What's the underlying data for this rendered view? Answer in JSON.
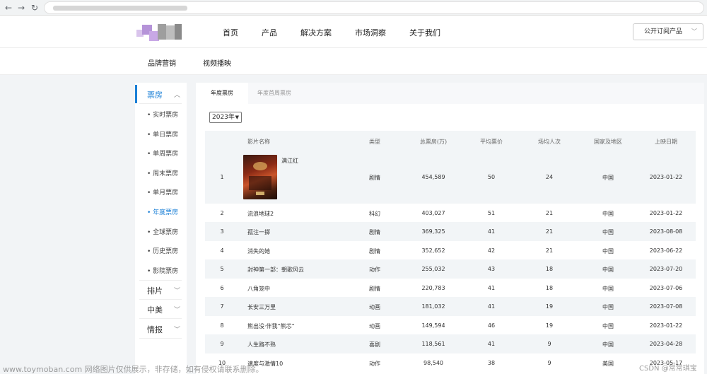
{
  "header": {
    "nav": [
      "首页",
      "产品",
      "解决方案",
      "市场洞察",
      "关于我们"
    ],
    "subscribe": "公开订阅产品"
  },
  "subnav": [
    "品牌营销",
    "视频播映"
  ],
  "sidebar": {
    "box_office": "票房",
    "sub_items": [
      "实时票房",
      "单日票房",
      "单周票房",
      "周末票房",
      "单月票房",
      "年度票房",
      "全球票房",
      "历史票房",
      "影院票房"
    ],
    "active_sub": "年度票房",
    "other_cats": [
      "排片",
      "中美",
      "情报"
    ]
  },
  "tabs": [
    "年度票房",
    "年度首周票房"
  ],
  "year_select": "2023年",
  "table": {
    "headers": [
      "影片名称",
      "类型",
      "总票房(万)",
      "平均票价",
      "场均人次",
      "国家及地区",
      "上映日期"
    ],
    "rows": [
      {
        "rank": "1",
        "name": "满江红",
        "type": "剧情",
        "total": "454,589",
        "price": "50",
        "avg": "24",
        "region": "中国",
        "date": "2023-01-22"
      },
      {
        "rank": "2",
        "name": "流浪地球2",
        "type": "科幻",
        "total": "403,027",
        "price": "51",
        "avg": "21",
        "region": "中国",
        "date": "2023-01-22"
      },
      {
        "rank": "3",
        "name": "孤注一掷",
        "type": "剧情",
        "total": "369,325",
        "price": "41",
        "avg": "21",
        "region": "中国",
        "date": "2023-08-08"
      },
      {
        "rank": "4",
        "name": "消失的她",
        "type": "剧情",
        "total": "352,652",
        "price": "42",
        "avg": "21",
        "region": "中国",
        "date": "2023-06-22"
      },
      {
        "rank": "5",
        "name": "封神第一部：朝歌风云",
        "type": "动作",
        "total": "255,032",
        "price": "43",
        "avg": "18",
        "region": "中国",
        "date": "2023-07-20"
      },
      {
        "rank": "6",
        "name": "八角笼中",
        "type": "剧情",
        "total": "220,783",
        "price": "41",
        "avg": "18",
        "region": "中国",
        "date": "2023-07-06"
      },
      {
        "rank": "7",
        "name": "长安三万里",
        "type": "动画",
        "total": "181,032",
        "price": "41",
        "avg": "19",
        "region": "中国",
        "date": "2023-07-08"
      },
      {
        "rank": "8",
        "name": "熊出没·伴我“熊芯”",
        "type": "动画",
        "total": "149,594",
        "price": "46",
        "avg": "19",
        "region": "中国",
        "date": "2023-01-22"
      },
      {
        "rank": "9",
        "name": "人生路不熟",
        "type": "喜剧",
        "total": "118,561",
        "price": "41",
        "avg": "9",
        "region": "中国",
        "date": "2023-04-28"
      },
      {
        "rank": "10",
        "name": "速度与激情10",
        "type": "动作",
        "total": "98,540",
        "price": "38",
        "avg": "9",
        "region": "美国",
        "date": "2023-05-17"
      }
    ]
  },
  "watermark": {
    "left": "www.toymoban.com 网络图片仅供展示，非存储，如有侵权请联系删除。",
    "right": "CSDN @常常琪宝"
  },
  "colors": {
    "accent": "#1a7fd6",
    "row_shade": "#f2f5f7",
    "page_bg": "#f2f4f6"
  },
  "icons": [
    "back-arrow-icon",
    "forward-arrow-icon",
    "refresh-icon",
    "chevron-up-icon",
    "chevron-down-icon"
  ]
}
